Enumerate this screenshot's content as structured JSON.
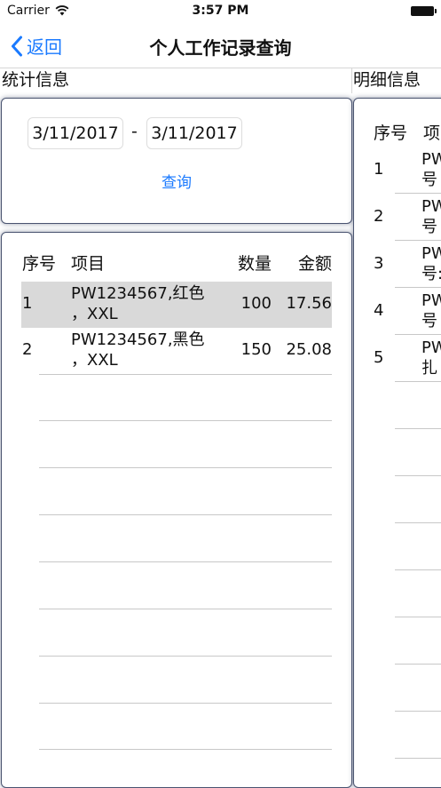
{
  "status_bar": {
    "carrier": "Carrier",
    "time": "3:57 PM",
    "icons": [
      "wifi-icon",
      "battery-icon"
    ]
  },
  "nav": {
    "back_label": "返回",
    "back_icon": "chevron-left-icon",
    "title": "个人工作记录查询",
    "accent_color": "#1a7aff"
  },
  "sections": {
    "stats_title": "统计信息",
    "detail_title": "明细信息"
  },
  "query": {
    "date_from": "3/11/2017",
    "separator": "-",
    "date_to": "3/11/2017",
    "button_label": "查询"
  },
  "stats_table": {
    "columns": [
      "序号",
      "项目",
      "数量",
      "金额"
    ],
    "rows": [
      {
        "no": "1",
        "item": "PW1234567,红色\n，XXL",
        "qty": "100",
        "amount": "17.56",
        "selected": true
      },
      {
        "no": "2",
        "item": "PW1234567,黑色\n，XXL",
        "qty": "150",
        "amount": "25.08",
        "selected": false
      }
    ],
    "selected_row_color": "#d9d9d9"
  },
  "detail_table": {
    "columns": [
      "序号",
      "项"
    ],
    "rows": [
      {
        "no": "1",
        "item": "PW\n号"
      },
      {
        "no": "2",
        "item": "PW\n号"
      },
      {
        "no": "3",
        "item": "PW\n号:"
      },
      {
        "no": "4",
        "item": "PW\n号"
      },
      {
        "no": "5",
        "item": "PW\n扎"
      }
    ]
  }
}
